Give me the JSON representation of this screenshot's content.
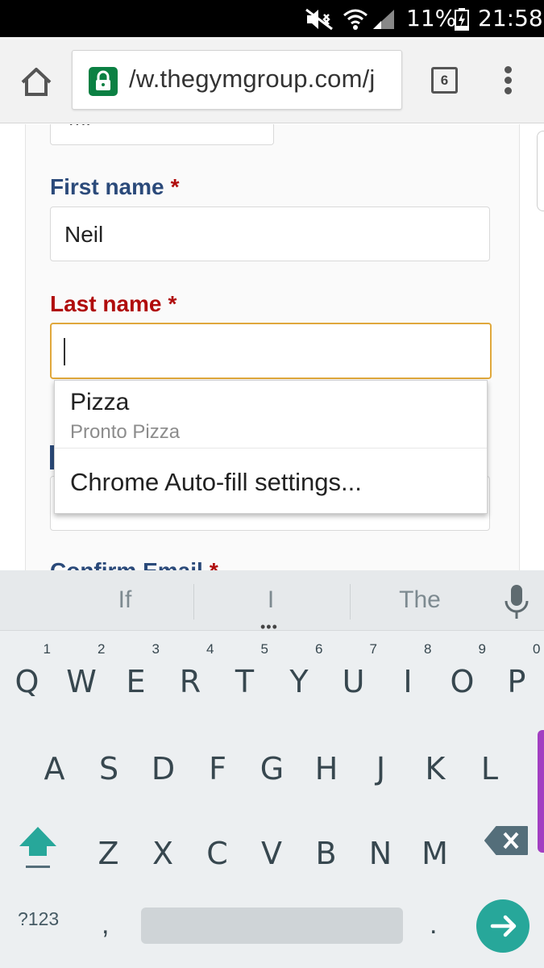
{
  "status_bar": {
    "battery": "11%",
    "time": "21:58",
    "icons": [
      "mute-icon",
      "wifi-icon",
      "signal-icon",
      "battery-charging-icon"
    ]
  },
  "browser": {
    "url": "/w.thegymgroup.com/j",
    "tab_count": "6",
    "icons": [
      "home-icon",
      "lock-icon",
      "tabs-icon",
      "overflow-menu-icon"
    ],
    "secure_color": "#0b8043"
  },
  "form": {
    "title_value": "Mr",
    "first_name_label": "First name",
    "first_name_value": "Neil",
    "last_name_label": "Last name",
    "last_name_value": "",
    "required_mark": "*",
    "confirm_email_label": "Confirm Email",
    "label_color": "#2b4a7a",
    "error_color": "#b00c0c",
    "focus_border_color": "#e0a83c"
  },
  "autofill": {
    "suggestion_main": "Pizza",
    "suggestion_sub": "Pronto Pizza",
    "settings_label": "Chrome Auto-fill settings..."
  },
  "keyboard": {
    "suggestions": [
      "If",
      "I",
      "The"
    ],
    "row1": [
      {
        "key": "Q",
        "hint": "1"
      },
      {
        "key": "W",
        "hint": "2"
      },
      {
        "key": "E",
        "hint": "3"
      },
      {
        "key": "R",
        "hint": "4"
      },
      {
        "key": "T",
        "hint": "5"
      },
      {
        "key": "Y",
        "hint": "6"
      },
      {
        "key": "U",
        "hint": "7"
      },
      {
        "key": "I",
        "hint": "8"
      },
      {
        "key": "O",
        "hint": "9"
      },
      {
        "key": "P",
        "hint": "0"
      }
    ],
    "row2": [
      "A",
      "S",
      "D",
      "F",
      "G",
      "H",
      "J",
      "K",
      "L"
    ],
    "row3": [
      "Z",
      "X",
      "C",
      "V",
      "B",
      "N",
      "M"
    ],
    "symbols_label": "?123",
    "comma": ",",
    "period": ".",
    "accent_color": "#27a79a"
  }
}
